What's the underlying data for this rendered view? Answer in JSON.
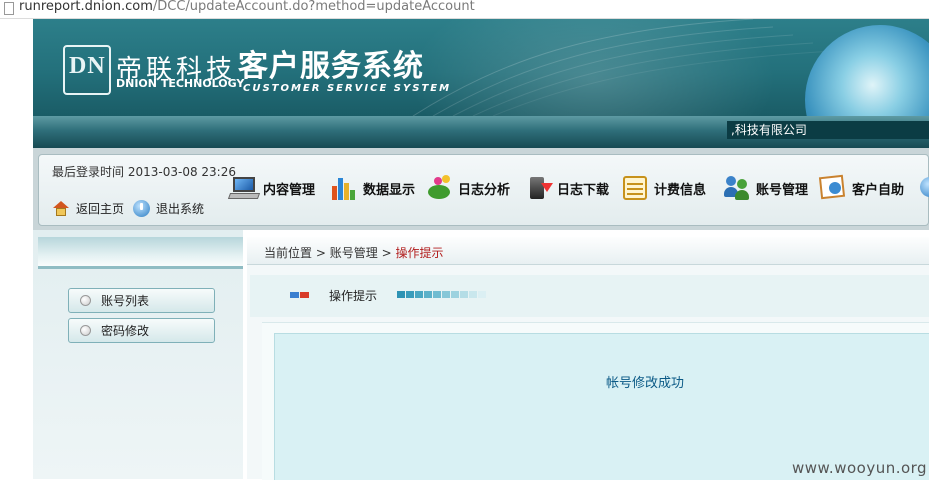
{
  "browser": {
    "url_host": "runreport.dnion.com",
    "url_path": "/DCC/updateAccount.do?method=updateAccount"
  },
  "banner": {
    "logo_mark": "DN",
    "brand_cn": "帝联科技",
    "brand_en": "DNION TECHNOLOGY",
    "system_cn": "客户服务系统",
    "system_en": "CUSTOMER SERVICE SYSTEM"
  },
  "company_name": ",科技有限公司",
  "header": {
    "last_login_label": "最后登录时间",
    "last_login_value": "2013-03-08 23:26",
    "home_label": "返回主页",
    "logout_label": "退出系统"
  },
  "nav": [
    {
      "label": "内容管理",
      "icon": "laptop-icon"
    },
    {
      "label": "数据显示",
      "icon": "bar-chart-icon"
    },
    {
      "label": "日志分析",
      "icon": "plant-icon"
    },
    {
      "label": "日志下载",
      "icon": "download-icon"
    },
    {
      "label": "计费信息",
      "icon": "calendar-icon"
    },
    {
      "label": "账号管理",
      "icon": "users-icon"
    },
    {
      "label": "客户自助",
      "icon": "help-card-icon"
    }
  ],
  "sidebar": {
    "items": [
      {
        "label": "账号列表"
      },
      {
        "label": "密码修改"
      }
    ]
  },
  "breadcrumb": {
    "label": "当前位置",
    "sep": ">",
    "section": "账号管理",
    "current": "操作提示"
  },
  "tip": {
    "label": "操作提示"
  },
  "message": "帐号修改成功",
  "watermark": "www.wooyun.org",
  "colors": {
    "banner": "#23707b",
    "company_bg": "#0b3c44",
    "crumb_current": "#b21e1e",
    "message": "#0b5a86"
  }
}
